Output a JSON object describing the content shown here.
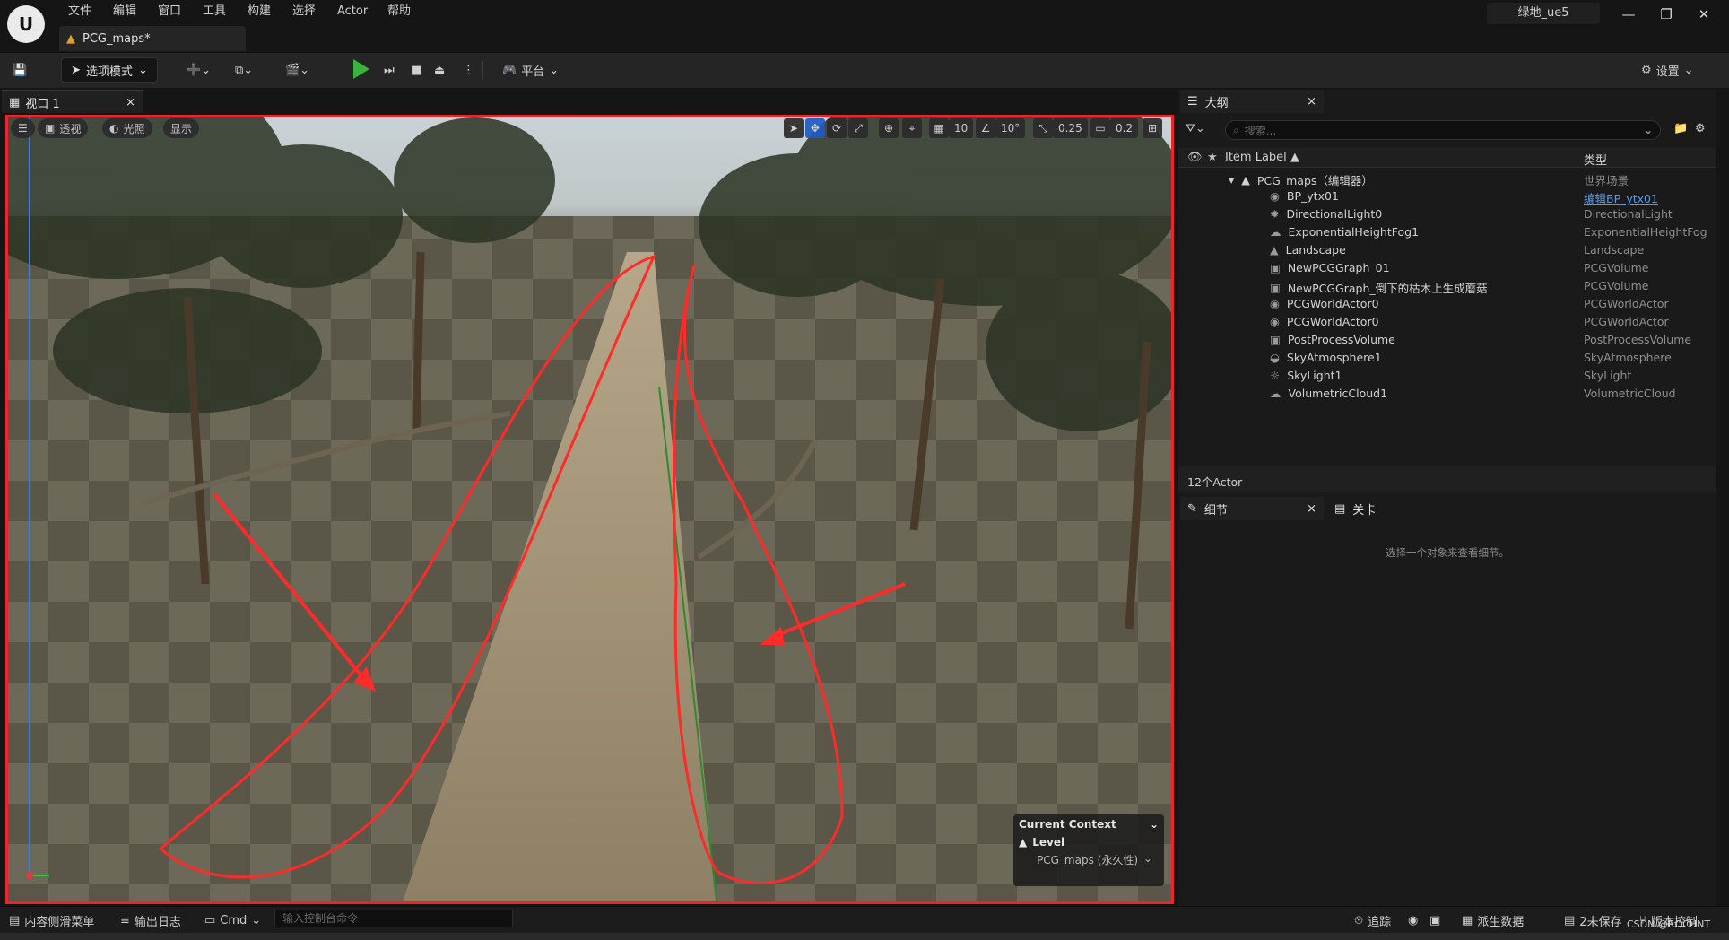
{
  "menu": {
    "items": [
      "文件",
      "编辑",
      "窗口",
      "工具",
      "构建",
      "选择",
      "Actor",
      "帮助"
    ],
    "project": "绿地_ue5"
  },
  "document_tab": {
    "label": "PCG_maps*"
  },
  "toolbar": {
    "mode_label": "选项模式",
    "platform_label": "平台",
    "settings_label": "设置"
  },
  "viewport": {
    "tab_label": "视口 1",
    "perspective_label": "透视",
    "lighting_label": "光照",
    "show_label": "显示",
    "grid_value": "10",
    "rotation_value": "10°",
    "scale_value": "0.25",
    "camera_speed": "0.2",
    "context": {
      "title": "Current Context",
      "level_label": "Level",
      "level_value": "PCG_maps (永久性)"
    }
  },
  "outliner": {
    "tab_label": "大纲",
    "search_placeholder": "搜索...",
    "col_label": "Item Label ▲",
    "col_type": "类型",
    "root": {
      "label": "PCG_maps（编辑器）",
      "type": "世界场景"
    },
    "rows": [
      {
        "label": "BP_ytx01",
        "type": "编辑BP_ytx01",
        "icon": "actor-icon",
        "link": true
      },
      {
        "label": "DirectionalLight0",
        "type": "DirectionalLight",
        "icon": "light-icon"
      },
      {
        "label": "ExponentialHeightFog1",
        "type": "ExponentialHeightFog",
        "icon": "fog-icon"
      },
      {
        "label": "Landscape",
        "type": "Landscape",
        "icon": "landscape-icon"
      },
      {
        "label": "NewPCGGraph_01",
        "type": "PCGVolume",
        "icon": "volume-icon"
      },
      {
        "label": "NewPCGGraph_倒下的枯木上生成蘑菇",
        "type": "PCGVolume",
        "icon": "volume-icon"
      },
      {
        "label": "PCGWorldActor0",
        "type": "PCGWorldActor",
        "icon": "actor-icon"
      },
      {
        "label": "PCGWorldActor0",
        "type": "PCGWorldActor",
        "icon": "actor-icon"
      },
      {
        "label": "PostProcessVolume",
        "type": "PostProcessVolume",
        "icon": "volume-icon"
      },
      {
        "label": "SkyAtmosphere1",
        "type": "SkyAtmosphere",
        "icon": "sky-icon"
      },
      {
        "label": "SkyLight1",
        "type": "SkyLight",
        "icon": "skylight-icon"
      },
      {
        "label": "VolumetricCloud1",
        "type": "VolumetricCloud",
        "icon": "cloud-icon"
      }
    ],
    "count": "12个Actor"
  },
  "details": {
    "tab_label": "细节",
    "levels_tab_label": "关卡",
    "empty_text": "选择一个对象来查看细节。"
  },
  "statusbar": {
    "content_drawer": "内容侧滑菜单",
    "output_log": "输出日志",
    "cmd": "Cmd",
    "console_placeholder": "输入控制台命令",
    "trace": "追踪",
    "derived_data": "派生数据",
    "unsaved": "2未保存",
    "source_control": "版本控制",
    "watermark": "CSDN @ROCHNT"
  }
}
